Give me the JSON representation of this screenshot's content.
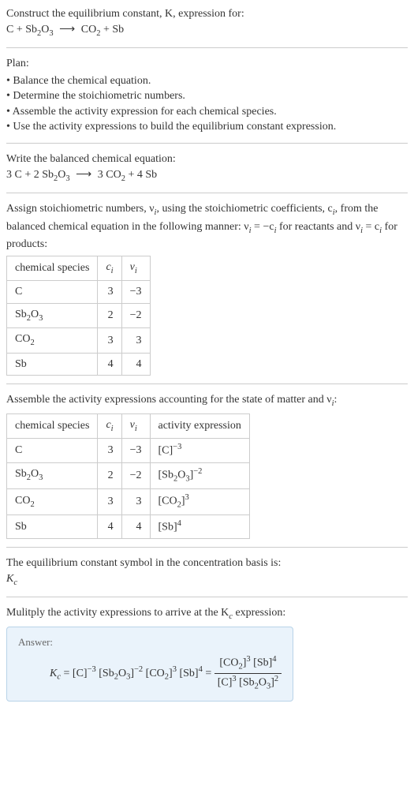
{
  "intro": {
    "line1": "Construct the equilibrium constant, K, expression for:",
    "equation_lhs": "C + Sb",
    "equation_sub1": "2",
    "equation_mid1": "O",
    "equation_sub2": "3",
    "equation_rhs1": "CO",
    "equation_rhs_sub": "2",
    "equation_rhs2": " + Sb",
    "arrow": "⟶"
  },
  "plan": {
    "header": "Plan:",
    "items": [
      "Balance the chemical equation.",
      "Determine the stoichiometric numbers.",
      "Assemble the activity expression for each chemical species.",
      "Use the activity expressions to build the equilibrium constant expression."
    ]
  },
  "balanced": {
    "header": "Write the balanced chemical equation:",
    "lhs": "3 C + 2 Sb",
    "sub1": "2",
    "mid1": "O",
    "sub2": "3",
    "arrow": "⟶",
    "rhs": "3 CO",
    "rhs_sub": "2",
    "rhs2": " + 4 Sb"
  },
  "stoich": {
    "header_a": "Assign stoichiometric numbers, ν",
    "header_a_sub": "i",
    "header_b": ", using the stoichiometric coefficients, c",
    "header_b_sub": "i",
    "header_c": ", from the balanced chemical equation in the following manner: ν",
    "header_c_sub": "i",
    "header_d": " = −c",
    "header_d_sub": "i",
    "header_e": " for reactants and ν",
    "header_e_sub": "i",
    "header_f": " = c",
    "header_f_sub": "i",
    "header_g": " for products:",
    "col1": "chemical species",
    "col2_a": "c",
    "col2_b": "i",
    "col3_a": "ν",
    "col3_b": "i",
    "rows": [
      {
        "species": "C",
        "sub": "",
        "c": "3",
        "v": "−3"
      },
      {
        "species": "Sb",
        "sub": "2O3",
        "c": "2",
        "v": "−2"
      },
      {
        "species": "CO",
        "sub": "2",
        "c": "3",
        "v": "3"
      },
      {
        "species": "Sb",
        "sub": "",
        "c": "4",
        "v": "4"
      }
    ]
  },
  "activity": {
    "header_a": "Assemble the activity expressions accounting for the state of matter and ν",
    "header_a_sub": "i",
    "header_b": ":",
    "col1": "chemical species",
    "col2_a": "c",
    "col2_b": "i",
    "col3_a": "ν",
    "col3_b": "i",
    "col4": "activity expression",
    "rows": [
      {
        "species": "C",
        "sub": "",
        "c": "3",
        "v": "−3",
        "act_base": "[C]",
        "act_sub": "",
        "act_exp": "−3"
      },
      {
        "species": "Sb",
        "sub": "2O3",
        "c": "2",
        "v": "−2",
        "act_base": "[Sb",
        "act_sub": "2O3",
        "act_close": "]",
        "act_exp": "−2"
      },
      {
        "species": "CO",
        "sub": "2",
        "c": "3",
        "v": "3",
        "act_base": "[CO",
        "act_sub": "2",
        "act_close": "]",
        "act_exp": "3"
      },
      {
        "species": "Sb",
        "sub": "",
        "c": "4",
        "v": "4",
        "act_base": "[Sb]",
        "act_sub": "",
        "act_exp": "4"
      }
    ]
  },
  "symbol": {
    "line1": "The equilibrium constant symbol in the concentration basis is:",
    "k": "K",
    "k_sub": "c"
  },
  "final": {
    "header_a": "Mulitply the activity expressions to arrive at the K",
    "header_a_sub": "c",
    "header_b": " expression:",
    "answer_label": "Answer:",
    "kc": "K",
    "kc_sub": "c",
    "eq": " = [C]",
    "e1": "−3",
    "t2": " [Sb",
    "t2sub": "2",
    "t2b": "O",
    "t2sub2": "3",
    "t2c": "]",
    "e2": "−2",
    "t3": " [CO",
    "t3sub": "2",
    "t3b": "]",
    "e3": "3",
    "t4": " [Sb]",
    "e4": "4",
    "eq2": " = ",
    "num_a": "[CO",
    "num_sub": "2",
    "num_b": "]",
    "num_e": "3",
    "num_c": " [Sb]",
    "num_e2": "4",
    "den_a": "[C]",
    "den_e": "3",
    "den_b": " [Sb",
    "den_sub": "2",
    "den_c": "O",
    "den_sub2": "3",
    "den_d": "]",
    "den_e2": "2"
  }
}
